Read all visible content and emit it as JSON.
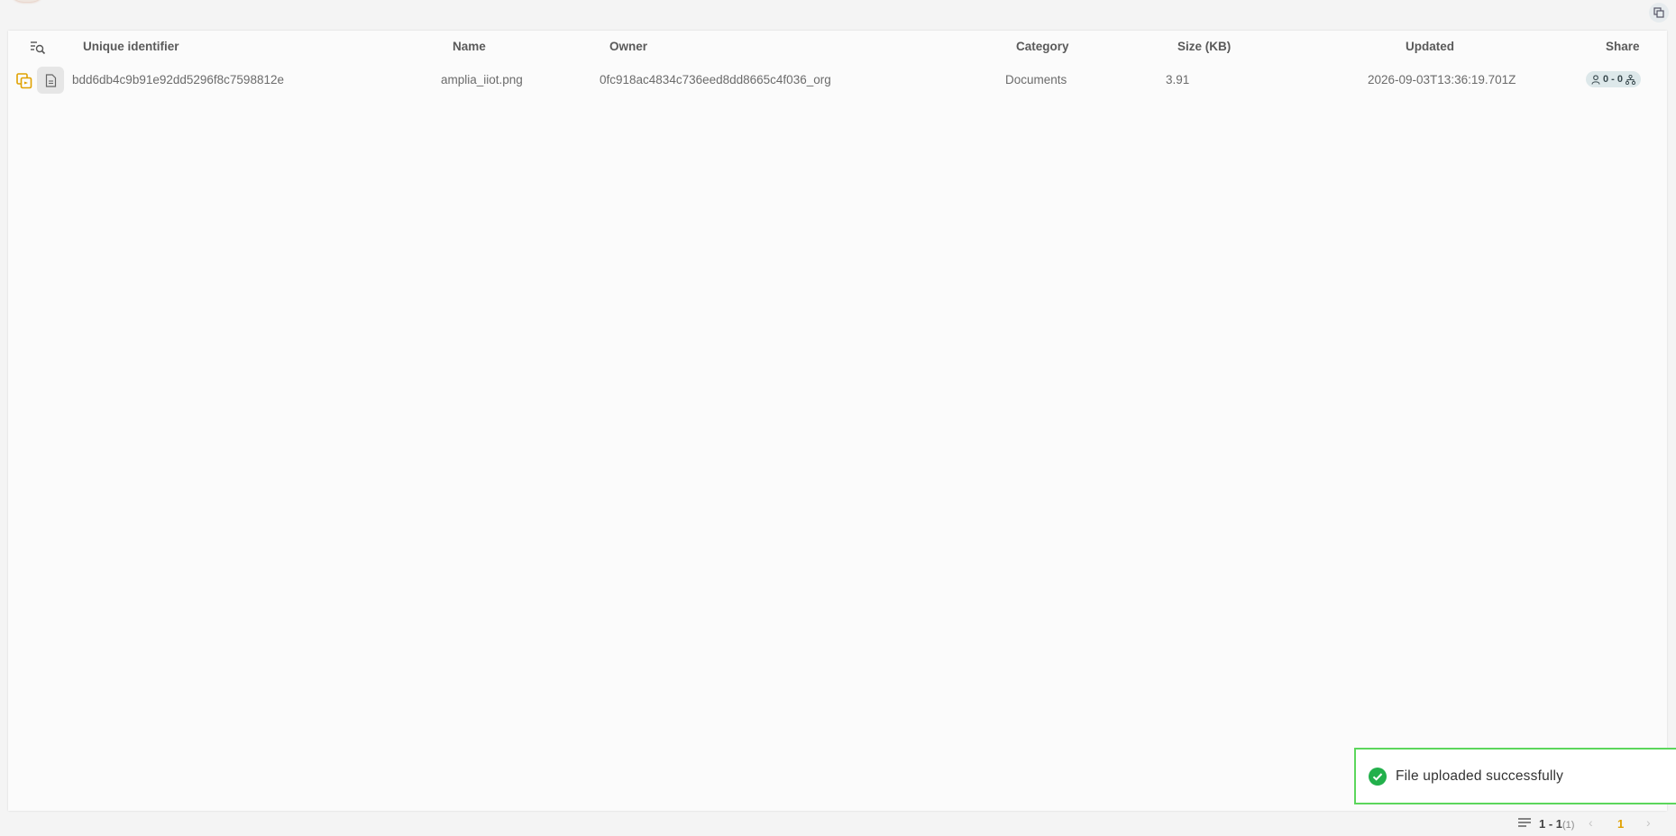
{
  "table": {
    "columns": {
      "uid": "Unique identifier",
      "name": "Name",
      "owner": "Owner",
      "category": "Category",
      "size": "Size (KB)",
      "updated": "Updated",
      "share": "Share"
    },
    "rows": [
      {
        "uid": "bdd6db4c9b91e92dd5296f8c7598812e",
        "name": "amplia_iiot.png",
        "owner": "0fc918ac4834c736eed8dd8665c4f036_org",
        "category": "Documents",
        "size": "3.91",
        "updated": "2026-09-03T13:36:19.701Z",
        "share": "0 - 0"
      }
    ]
  },
  "toast": {
    "message": "File uploaded successfully",
    "color": "#5cd65c"
  },
  "pagination": {
    "range": "1 - 1",
    "total": "(1)",
    "current_page": "1"
  },
  "colors": {
    "accent": "#e0a100",
    "copy_icon": "#e0a100",
    "success": "#22b04b"
  }
}
